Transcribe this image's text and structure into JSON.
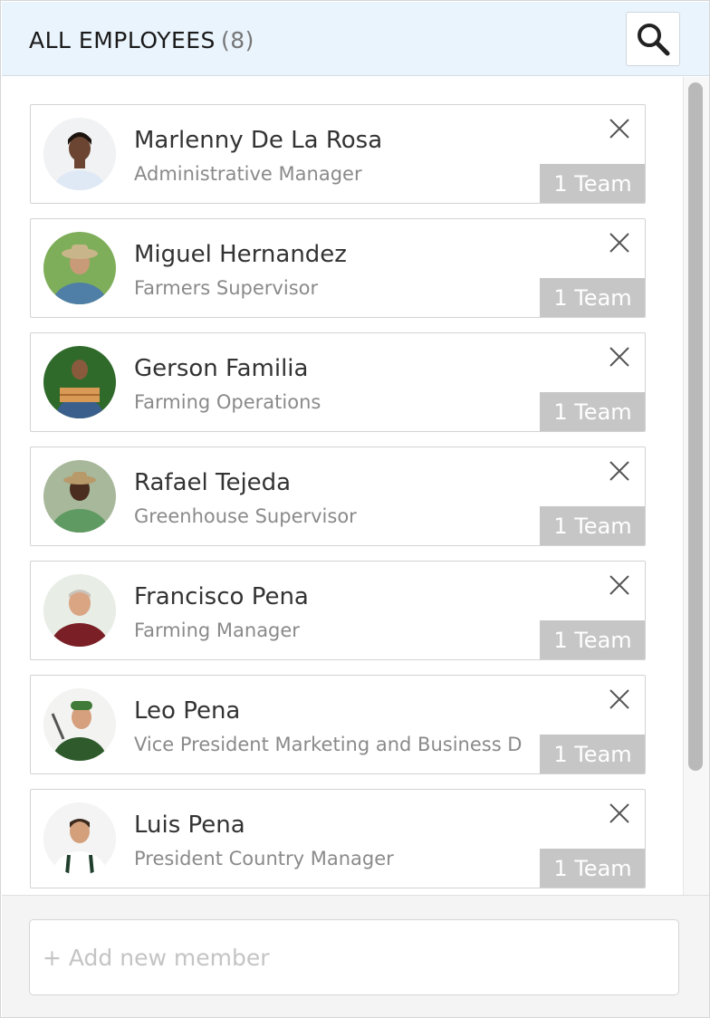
{
  "header": {
    "title": "ALL EMPLOYEES",
    "count": "(8)",
    "search_icon": "search-icon"
  },
  "employees": [
    {
      "name": "Marlenny De La Rosa",
      "role": "Administrative Manager",
      "team": "1 Team"
    },
    {
      "name": "Miguel Hernandez",
      "role": "Farmers Supervisor",
      "team": "1 Team"
    },
    {
      "name": "Gerson Familia",
      "role": "Farming Operations",
      "team": "1 Team"
    },
    {
      "name": "Rafael Tejeda",
      "role": "Greenhouse Supervisor",
      "team": "1 Team"
    },
    {
      "name": "Francisco Pena",
      "role": "Farming Manager",
      "team": "1 Team"
    },
    {
      "name": "Leo Pena",
      "role": "Vice President Marketing and Business D",
      "team": "1 Team"
    },
    {
      "name": "Luis Pena",
      "role": "President Country Manager",
      "team": "1 Team"
    }
  ],
  "footer": {
    "add_placeholder": "+ Add new member"
  },
  "colors": {
    "header_bg": "#e9f4fd",
    "badge_bg": "#c6c6c6",
    "scrollbar": "#b9b9b9"
  }
}
